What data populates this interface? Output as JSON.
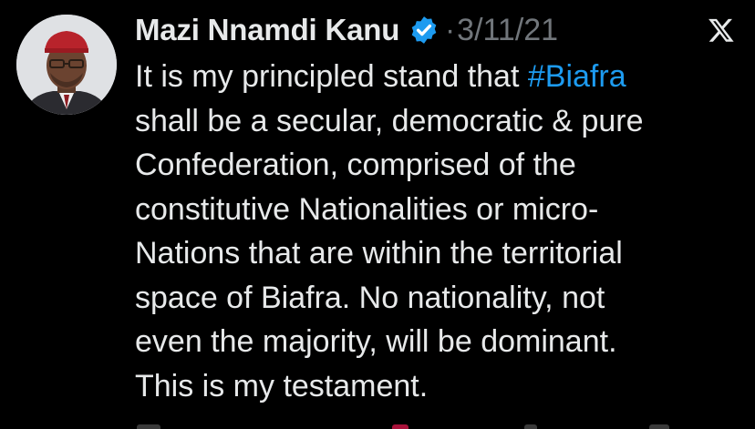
{
  "tweet": {
    "author": "Mazi Nnamdi Kanu",
    "separator": "·",
    "date": "3/11/21",
    "hashtag": "#Biafra",
    "hashtag_color": "#1d9bf0",
    "lines": {
      "l1_prefix": "It is my principled stand that ",
      "l2": "shall be a secular, democratic & pure",
      "l3": "Confederation, comprised of the",
      "l4": "constitutive Nationalities or micro-",
      "l5": "Nations that are within the territorial",
      "l6": "space of Biafra. No nationality, not",
      "l7": "even the majority, will be dominant.",
      "l8": "This is my testament."
    }
  },
  "icons": {
    "verified": "verified-badge-icon",
    "platform": "x-logo-icon",
    "avatar": "profile-avatar"
  },
  "colors": {
    "background": "#000000",
    "text": "#e7e9ea",
    "muted": "#71767b",
    "accent": "#1d9bf0"
  }
}
